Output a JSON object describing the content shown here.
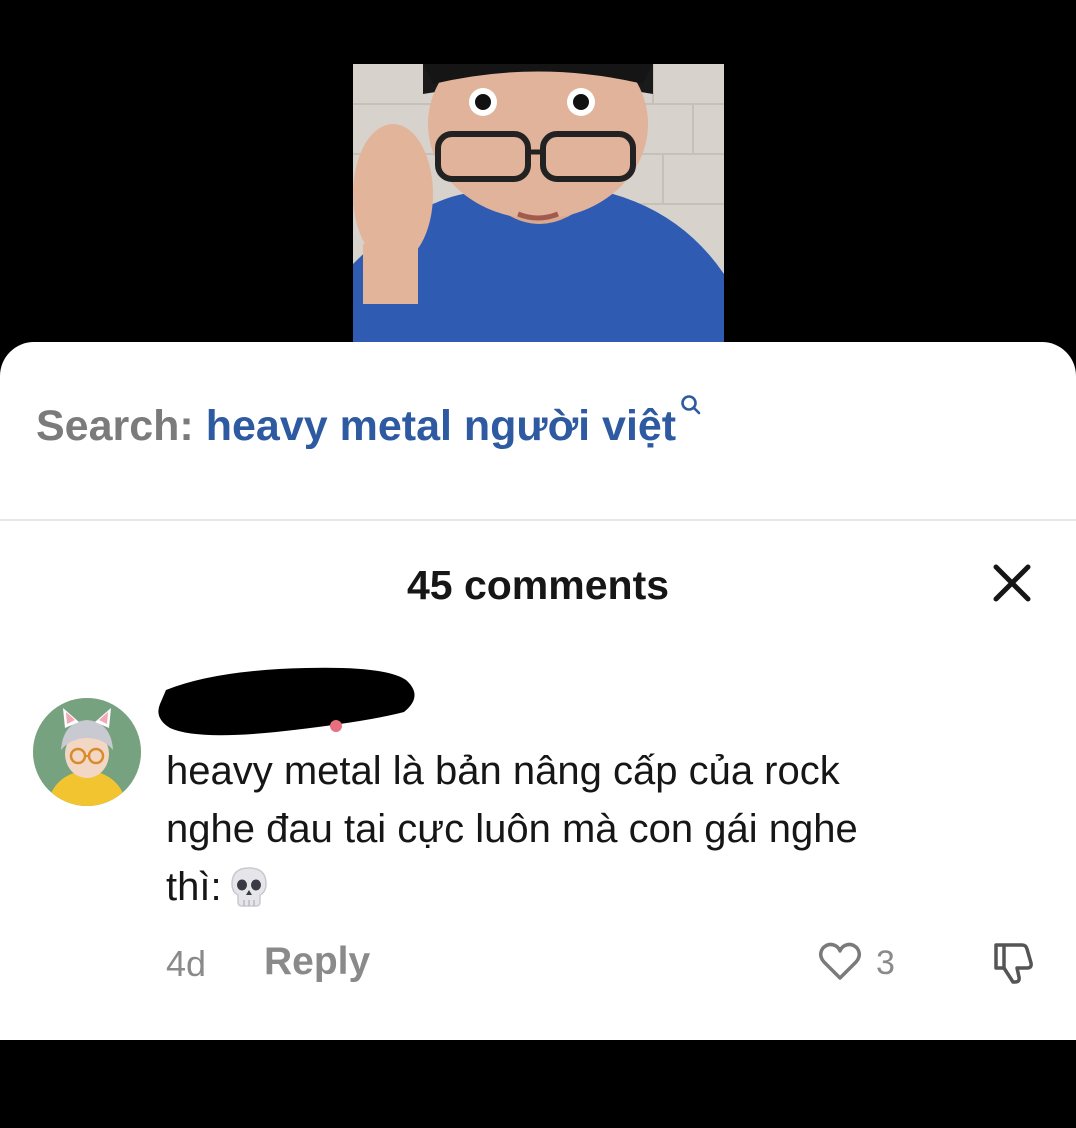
{
  "search": {
    "label": "Search:",
    "term": "heavy metal người việt",
    "icon": "search-icon"
  },
  "comments_panel": {
    "title": "45 comments",
    "close_icon": "close-icon"
  },
  "comment": {
    "avatar": "avatar",
    "text_lines": [
      "heavy metal là bản nâng cấp của rock",
      "nghe đau tai cực luôn mà con gái nghe",
      "thì:"
    ],
    "emoji": "skull-emoji",
    "time": "4d",
    "reply_label": "Reply",
    "like_count": "3",
    "like_icon": "heart-icon",
    "dislike_icon": "thumbs-down-icon"
  },
  "colors": {
    "sheet_bg": "#ffffff",
    "page_bg": "#000000",
    "search_term": "#2d5aa0",
    "muted": "#8a8a8a",
    "text": "#161616"
  }
}
